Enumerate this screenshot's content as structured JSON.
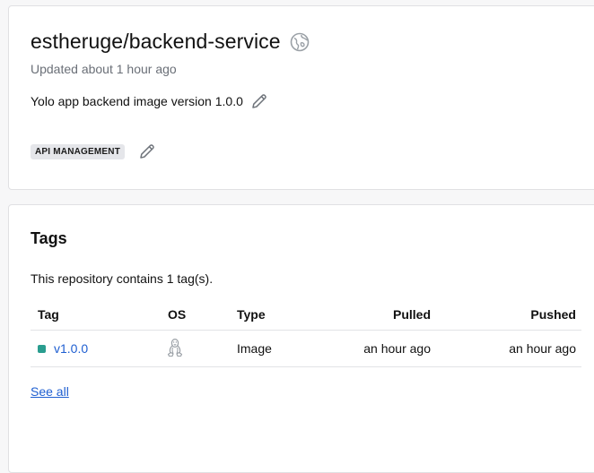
{
  "repo": {
    "title": "estheruge/backend-service",
    "updated": "Updated about 1 hour ago",
    "description": "Yolo app backend image version 1.0.0",
    "category": "API MANAGEMENT"
  },
  "tags": {
    "title": "Tags",
    "summary": "This repository contains 1 tag(s).",
    "columns": {
      "tag": "Tag",
      "os": "OS",
      "type": "Type",
      "pulled": "Pulled",
      "pushed": "Pushed"
    },
    "rows": [
      {
        "tag": "v1.0.0",
        "os_icon": "linux-icon",
        "type": "Image",
        "pulled": "an hour ago",
        "pushed": "an hour ago"
      }
    ],
    "see_all": "See all"
  },
  "colors": {
    "link": "#1f5fd1",
    "status_active": "#2a9d8f",
    "badge_bg": "#e5e6ea"
  },
  "icons": {
    "visibility": "public-globe-icon",
    "edit": "pencil-icon"
  }
}
